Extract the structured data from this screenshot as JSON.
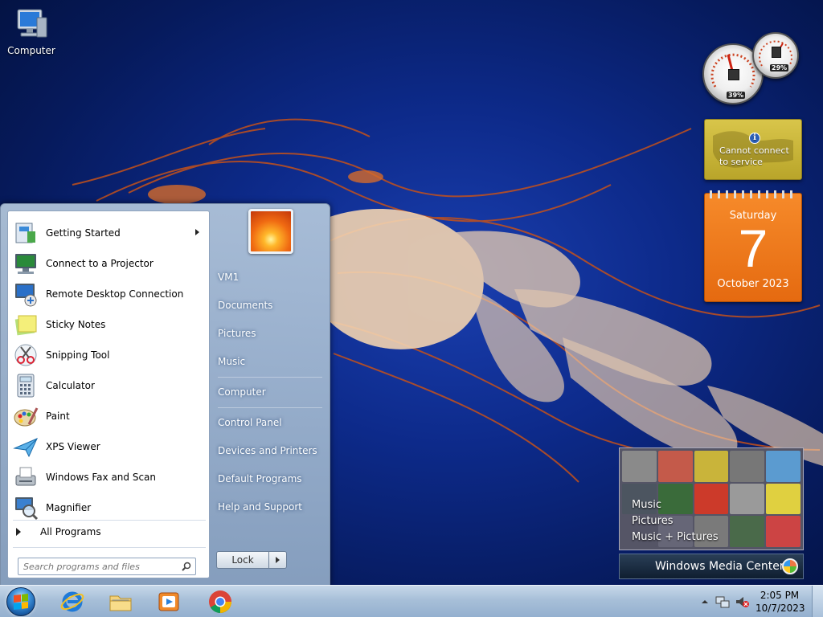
{
  "desktop": {
    "icons": [
      {
        "label": "Computer",
        "icon": "computer-icon"
      }
    ]
  },
  "gadgets": {
    "cpu_meter": {
      "cpu_percent": "39%",
      "memory_percent": "29%"
    },
    "weather": {
      "message_line1": "Cannot connect",
      "message_line2": "to service",
      "icon": "info-icon"
    },
    "calendar": {
      "weekday": "Saturday",
      "day": "7",
      "month_year": "October 2023"
    },
    "media_center": {
      "items": [
        "Music",
        "Pictures",
        "Music + Pictures"
      ],
      "title": "Windows Media Center"
    }
  },
  "start_menu": {
    "programs": [
      {
        "label": "Getting Started",
        "icon": "getting-started-icon",
        "has_submenu": true
      },
      {
        "label": "Connect to a Projector",
        "icon": "projector-icon"
      },
      {
        "label": "Remote Desktop Connection",
        "icon": "remote-desktop-icon"
      },
      {
        "label": "Sticky Notes",
        "icon": "sticky-notes-icon"
      },
      {
        "label": "Snipping Tool",
        "icon": "snipping-tool-icon"
      },
      {
        "label": "Calculator",
        "icon": "calculator-icon"
      },
      {
        "label": "Paint",
        "icon": "paint-icon"
      },
      {
        "label": "XPS Viewer",
        "icon": "xps-viewer-icon"
      },
      {
        "label": "Windows Fax and Scan",
        "icon": "fax-scan-icon"
      },
      {
        "label": "Magnifier",
        "icon": "magnifier-icon"
      }
    ],
    "all_programs": "All Programs",
    "search_placeholder": "Search programs and files",
    "right_links": {
      "user": "VM1",
      "documents": "Documents",
      "pictures": "Pictures",
      "music": "Music",
      "computer": "Computer",
      "control_panel": "Control Panel",
      "devices_printers": "Devices and Printers",
      "default_programs": "Default Programs",
      "help_support": "Help and Support"
    },
    "lock_label": "Lock"
  },
  "taskbar": {
    "pinned": [
      {
        "name": "internet-explorer",
        "icon": "internet-explorer-icon"
      },
      {
        "name": "windows-explorer",
        "icon": "folder-icon"
      },
      {
        "name": "media-player",
        "icon": "media-player-icon"
      },
      {
        "name": "chrome",
        "icon": "chrome-icon"
      }
    ],
    "clock": {
      "time": "2:05 PM",
      "date": "10/7/2023"
    }
  },
  "colors": {
    "desktop_bg": "#0d2a8a",
    "calendar_orange": "#e56a10",
    "weather_yellow": "#c8b534",
    "taskbar": "#a7bfd8"
  }
}
